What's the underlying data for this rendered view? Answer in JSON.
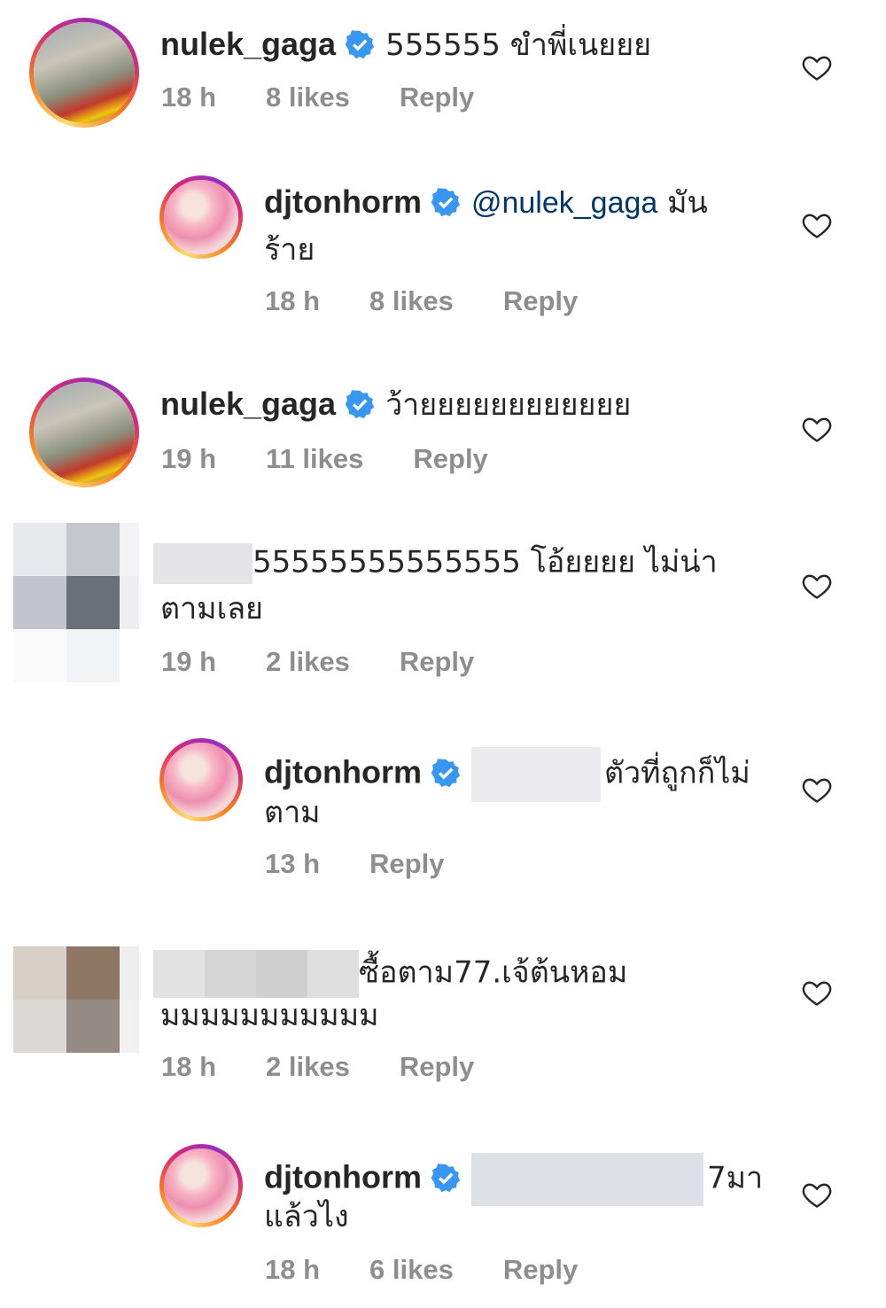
{
  "comments": [
    {
      "username": "nulek_gaga",
      "text": "555555 ขำพี่เนยยย",
      "time": "18 h",
      "likes": "8 likes",
      "reply": "Reply"
    },
    {
      "username": "djtonhorm",
      "mention": "@nulek_gaga",
      "text": " มัน",
      "text2": "ร้าย",
      "time": "18 h",
      "likes": "8 likes",
      "reply": "Reply"
    },
    {
      "username": "nulek_gaga",
      "text": "ว้ายยยยยยยยยยยย",
      "time": "19 h",
      "likes": "11 likes",
      "reply": "Reply"
    },
    {
      "username": "",
      "text": "55555555555555 โอ้ยยยย ไม่น่า",
      "text2": "ตามเลย",
      "time": "19 h",
      "likes": "2 likes",
      "reply": "Reply"
    },
    {
      "username": "djtonhorm",
      "text": "ตัวที่ถูกก็ไม่",
      "text2": "ตาม",
      "time": "13 h",
      "reply": "Reply"
    },
    {
      "username": "",
      "text": "ซื้อตาม77.เจ้ต้นหอม",
      "text2": "มมมมมมมมมมม",
      "time": "18 h",
      "likes": "2 likes",
      "reply": "Reply"
    },
    {
      "username": "djtonhorm",
      "text": "7มา",
      "text2": "แล้วไง",
      "time": "18 h",
      "likes": "6 likes",
      "reply": "Reply"
    }
  ],
  "colors": {
    "verified": "#3897f0",
    "meta": "#8e8e8e",
    "mention": "#00376b",
    "text": "#262626"
  },
  "icons": {
    "like": "heart-outline-icon",
    "verified": "verified-badge-icon"
  }
}
